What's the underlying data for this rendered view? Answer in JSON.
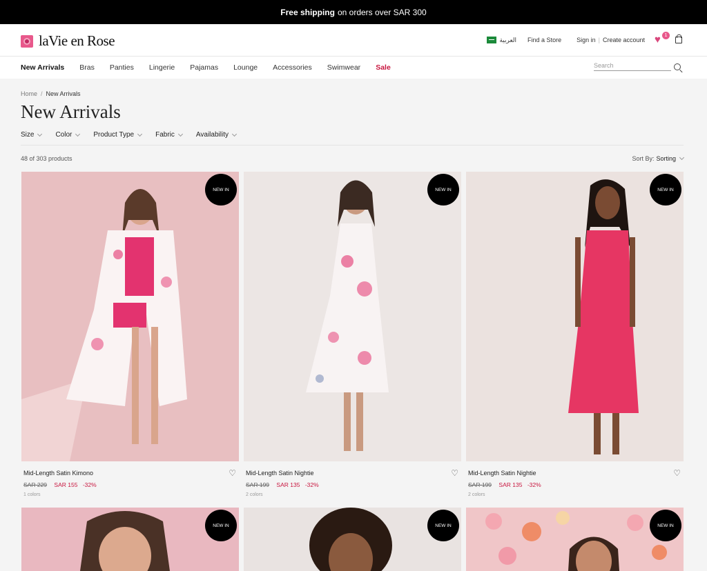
{
  "promo": {
    "bold": "Free shipping",
    "rest": "on orders over SAR 300"
  },
  "header": {
    "logo": "laVie en Rose",
    "language": "العربية",
    "find_store": "Find a Store",
    "sign_in": "Sign in",
    "create_account": "Create account",
    "wishlist_count": "1"
  },
  "nav": {
    "items": [
      "New Arrivals",
      "Bras",
      "Panties",
      "Lingerie",
      "Pajamas",
      "Lounge",
      "Accessories",
      "Swimwear",
      "Sale"
    ],
    "search_placeholder": "Search"
  },
  "breadcrumb": {
    "home": "Home",
    "current": "New Arrivals"
  },
  "page_title": "New Arrivals",
  "filters": [
    "Size",
    "Color",
    "Product Type",
    "Fabric",
    "Availability"
  ],
  "product_count": "48 of 303 products",
  "sort": {
    "label": "Sort By:",
    "value": "Sorting"
  },
  "products": [
    {
      "badge": "NEW IN",
      "name": "Mid-Length Satin Kimono",
      "old_price": "SAR 229",
      "new_price": "SAR 155",
      "discount": "-32%",
      "colors": "1 colors"
    },
    {
      "badge": "NEW IN",
      "name": "Mid-Length Satin Nightie",
      "old_price": "SAR 199",
      "new_price": "SAR 135",
      "discount": "-32%",
      "colors": "2 colors"
    },
    {
      "badge": "NEW IN",
      "name": "Mid-Length Satin Nightie",
      "old_price": "SAR 199",
      "new_price": "SAR 135",
      "discount": "-32%",
      "colors": "2 colors"
    },
    {
      "badge": "NEW IN"
    },
    {
      "badge": "NEW IN"
    },
    {
      "badge": "NEW IN"
    }
  ],
  "colors": {
    "accent": "#e8588b",
    "sale": "#c8163f",
    "promo_bg": "#000000"
  }
}
